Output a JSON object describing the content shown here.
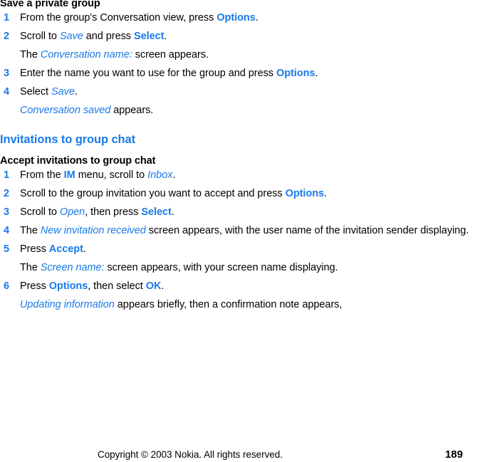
{
  "page": {
    "number": "189",
    "copyright": "Copyright © 2003 Nokia. All rights reserved."
  },
  "colors": {
    "accent_blue": "#1a7ae8",
    "text_black": "#000000",
    "background": "#ffffff"
  },
  "sections": [
    {
      "heading": "Save a private group",
      "heading_style": "bold-black",
      "steps": [
        {
          "number": "1",
          "runs": [
            {
              "text": "From the group's Conversation view, press ",
              "style": "plain"
            },
            {
              "text": "Options",
              "style": "bold-blue"
            },
            {
              "text": ".",
              "style": "plain"
            }
          ]
        },
        {
          "number": "2",
          "runs": [
            {
              "text": "Scroll to ",
              "style": "plain"
            },
            {
              "text": "Save",
              "style": "italic-blue"
            },
            {
              "text": " and press ",
              "style": "plain"
            },
            {
              "text": "Select",
              "style": "bold-blue"
            },
            {
              "text": ".",
              "style": "plain"
            }
          ]
        },
        {
          "number": "",
          "runs": [
            {
              "text": "The ",
              "style": "plain"
            },
            {
              "text": "Conversation name:",
              "style": "italic-blue"
            },
            {
              "text": " screen appears.",
              "style": "plain"
            }
          ]
        },
        {
          "number": "3",
          "runs": [
            {
              "text": "Enter the name you want to use for the group and press ",
              "style": "plain"
            },
            {
              "text": "Options",
              "style": "bold-blue"
            },
            {
              "text": ".",
              "style": "plain"
            }
          ]
        },
        {
          "number": "4",
          "runs": [
            {
              "text": "Select ",
              "style": "plain"
            },
            {
              "text": "Save",
              "style": "italic-blue"
            },
            {
              "text": ".",
              "style": "plain"
            }
          ]
        },
        {
          "number": "",
          "runs": [
            {
              "text": "Conversation saved",
              "style": "italic-blue"
            },
            {
              "text": " appears.",
              "style": "plain"
            }
          ]
        }
      ]
    },
    {
      "heading": "Invitations to group chat",
      "heading_style": "bold-blue",
      "subheading": "Accept invitations to group chat",
      "steps": [
        {
          "number": "1",
          "runs": [
            {
              "text": "From the ",
              "style": "plain"
            },
            {
              "text": "IM",
              "style": "bold-blue"
            },
            {
              "text": " menu, scroll to ",
              "style": "plain"
            },
            {
              "text": "Inbox",
              "style": "italic-blue"
            },
            {
              "text": ".",
              "style": "plain"
            }
          ]
        },
        {
          "number": "2",
          "runs": [
            {
              "text": "Scroll to the group invitation you want to accept and press ",
              "style": "plain"
            },
            {
              "text": "Options",
              "style": "bold-blue"
            },
            {
              "text": ".",
              "style": "plain"
            }
          ]
        },
        {
          "number": "3",
          "runs": [
            {
              "text": "Scroll to ",
              "style": "plain"
            },
            {
              "text": "Open",
              "style": "italic-blue"
            },
            {
              "text": ", then press ",
              "style": "plain"
            },
            {
              "text": "Select",
              "style": "bold-blue"
            },
            {
              "text": ".",
              "style": "plain"
            }
          ]
        },
        {
          "number": "4",
          "runs": [
            {
              "text": "The ",
              "style": "plain"
            },
            {
              "text": "New invitation received",
              "style": "italic-blue"
            },
            {
              "text": " screen appears, with the user name of the invitation sender displaying.",
              "style": "plain"
            }
          ]
        },
        {
          "number": "5",
          "runs": [
            {
              "text": "Press ",
              "style": "plain"
            },
            {
              "text": "Accept",
              "style": "bold-blue"
            },
            {
              "text": ".",
              "style": "plain"
            }
          ]
        },
        {
          "number": "",
          "runs": [
            {
              "text": "The ",
              "style": "plain"
            },
            {
              "text": "Screen name:",
              "style": "italic-blue"
            },
            {
              "text": " screen appears, with your screen name displaying.",
              "style": "plain"
            }
          ]
        },
        {
          "number": "6",
          "runs": [
            {
              "text": "Press ",
              "style": "plain"
            },
            {
              "text": "Options",
              "style": "bold-blue"
            },
            {
              "text": ", then select ",
              "style": "plain"
            },
            {
              "text": "OK",
              "style": "bold-blue"
            },
            {
              "text": ".",
              "style": "plain"
            }
          ]
        },
        {
          "number": "",
          "runs": [
            {
              "text": "Updating information",
              "style": "italic-blue"
            },
            {
              "text": " appears briefly, then a confirmation note appears,",
              "style": "plain"
            }
          ]
        }
      ]
    }
  ]
}
